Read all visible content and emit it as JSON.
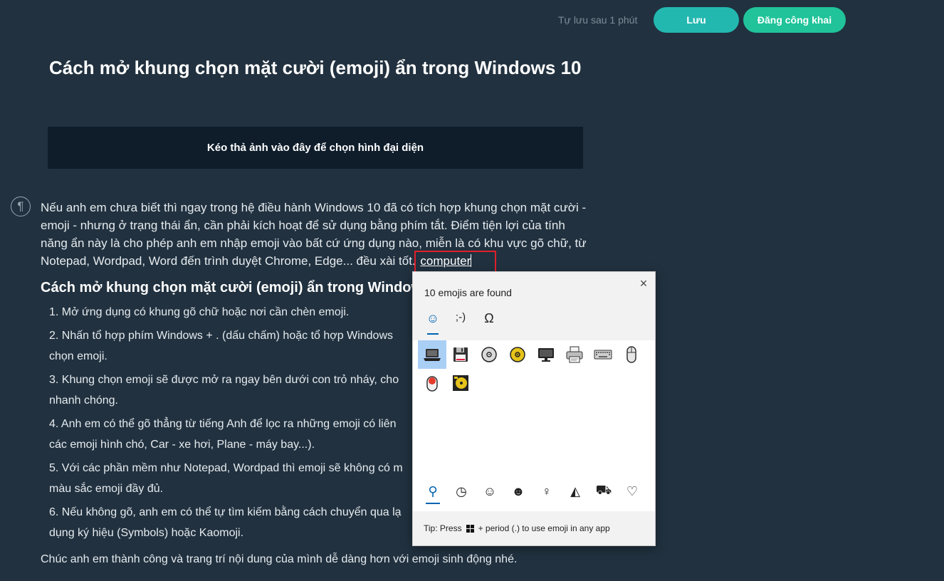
{
  "header": {
    "autosave_text": "Tự lưu sau 1 phút",
    "save_label": "Lưu",
    "publish_label": "Đăng công khai"
  },
  "editor": {
    "title": "Cách mở khung chọn mặt cười (emoji) ẩn trong Windows 10",
    "cover_placeholder": "Kéo thả ảnh vào đây để chọn hình đại diện",
    "paragraph_icon": "¶",
    "intro_text": "Nếu anh em chưa biết thì ngay trong hệ điều hành Windows 10 đã có tích hợp khung chọn mặt cười - emoji - nhưng ở trạng thái ẩn, cần phải kích hoạt để sử dụng bằng phím tắt. Điểm tiện lợi của tính năng ẩn này là cho phép anh em nhập emoji vào bất cứ ứng dụng nào, miễn là có khu vực gõ chữ, từ Notepad, Wordpad, Word đến trình duyệt Chrome, Edge... đều xài tốt.",
    "typed_word": "computer",
    "section_heading": "Cách mở khung chọn mặt cười (emoji) ẩn trong Windows",
    "steps": [
      "1. Mở ứng dụng có khung gõ chữ hoặc nơi cần chèn emoji.",
      "2. Nhấn tổ hợp phím Windows + . (dấu chấm) hoặc tổ hợp Windows",
      "chọn emoji.",
      "3. Khung chọn emoji sẽ được mở ra ngay bên dưới con trỏ nháy, cho",
      "nhanh chóng.",
      "4. Anh em có thể gõ thẳng từ tiếng Anh để lọc ra những emoji có liên",
      "các emoji hình chó, Car - xe hơi, Plane - máy bay...).",
      "5. Với các phần mềm như Notepad, Wordpad thì emoji sẽ không có m",
      "màu sắc emoji đầy đủ.",
      "6. Nếu không gõ, anh em có thể tự tìm kiếm bằng cách chuyển qua lạ",
      "dụng ký hiệu (Symbols) hoặc Kaomoji."
    ],
    "closing_text": "Chúc anh em thành công và trang trí nội dung của mình dễ dàng hơn với emoji sinh động nhé."
  },
  "emoji_panel": {
    "status": "10 emojis are found",
    "close_icon": "×",
    "category_tabs": [
      {
        "name": "emoji-smiley-tab",
        "glyph": "☺",
        "active": true
      },
      {
        "name": "kaomoji-tab",
        "glyph": ";-)",
        "active": false
      },
      {
        "name": "symbols-tab",
        "glyph": "Ω",
        "active": false
      }
    ],
    "results": [
      {
        "name": "laptop-emoji",
        "selected": true
      },
      {
        "name": "floppy-disk-emoji",
        "selected": false
      },
      {
        "name": "optical-disc-emoji",
        "selected": false
      },
      {
        "name": "dvd-emoji",
        "selected": false
      },
      {
        "name": "desktop-computer-emoji",
        "selected": false
      },
      {
        "name": "printer-emoji",
        "selected": false
      },
      {
        "name": "keyboard-emoji",
        "selected": false
      },
      {
        "name": "computer-mouse-emoji",
        "selected": false
      },
      {
        "name": "trackball-emoji",
        "selected": false
      },
      {
        "name": "minidisc-emoji",
        "selected": false
      }
    ],
    "nav": [
      {
        "name": "search-nav-icon",
        "glyph": "⚲",
        "active": true
      },
      {
        "name": "recent-nav-icon",
        "glyph": "◷",
        "active": false
      },
      {
        "name": "smileys-nav-icon",
        "glyph": "☺",
        "active": false
      },
      {
        "name": "people-nav-icon",
        "glyph": "☻",
        "active": false
      },
      {
        "name": "celebration-nav-icon",
        "glyph": "♀",
        "active": false
      },
      {
        "name": "food-nav-icon",
        "glyph": "◭",
        "active": false
      },
      {
        "name": "travel-nav-icon",
        "glyph": "⛟",
        "active": false
      },
      {
        "name": "symbols-heart-nav-icon",
        "glyph": "♡",
        "active": false
      }
    ],
    "tip_prefix": "Tip: Press",
    "tip_suffix": "+ period (.) to use emoji in any app"
  },
  "colors": {
    "background": "#21313f",
    "save_button": "#22b8b0",
    "publish_button": "#20c39a",
    "selection_box": "#e0202a",
    "panel_accent": "#0063b1"
  }
}
